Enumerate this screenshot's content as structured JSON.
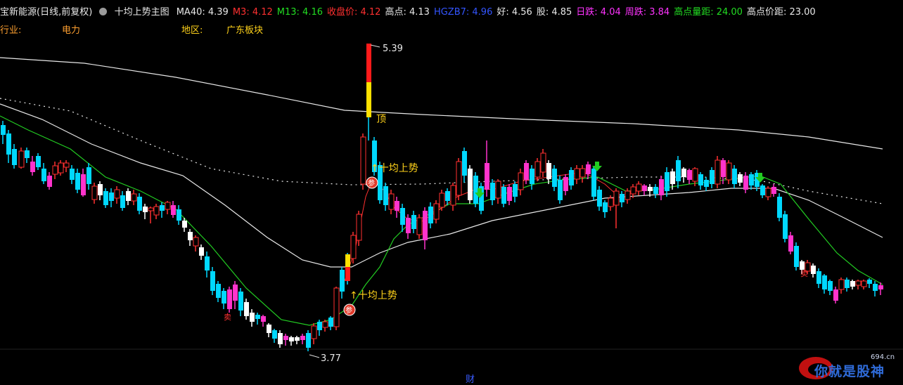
{
  "header": {
    "stock": "宝新能源(日线,前复权)",
    "indicator": "十均上势主图",
    "items": [
      {
        "label": "MA40:",
        "value": "4.39",
        "color": "#e8e8e8"
      },
      {
        "label": "M3:",
        "value": "4.12",
        "color": "#ff3030"
      },
      {
        "label": "M13:",
        "value": "4.16",
        "color": "#22dd22"
      },
      {
        "label": "收盘价:",
        "value": "4.12",
        "color": "#ff3030"
      },
      {
        "label": "高点:",
        "value": "4.13",
        "color": "#e8e8e8"
      },
      {
        "label": "HGZB7:",
        "value": "4.96",
        "color": "#3355ff"
      },
      {
        "label": "好:",
        "value": "4.56",
        "color": "#e8e8e8"
      },
      {
        "label": "股:",
        "value": "4.85",
        "color": "#e8e8e8"
      },
      {
        "label": "日跌:",
        "value": "4.04",
        "color": "#ff33ff"
      },
      {
        "label": "周跌:",
        "value": "3.84",
        "color": "#ff33ff"
      },
      {
        "label": "高点量距:",
        "value": "24.00",
        "color": "#22dd22"
      },
      {
        "label": "高点价距:",
        "value": "23.00",
        "color": "#e8e8e8"
      }
    ]
  },
  "info": {
    "industry_label": "行业:",
    "industry_value": "电力",
    "region_label": "地区:",
    "region_value": "广东板块"
  },
  "chart_annotations": {
    "high_label": "5.39",
    "low_label": "3.77",
    "top_marker": "顶",
    "signal_1": "↑十均上势",
    "signal_2": "↑十均上势",
    "badge": "参",
    "bottom_marker": "财",
    "sell_marker": "卖"
  },
  "watermark": {
    "site": "694.cn",
    "text": "你就是股神"
  },
  "chart_data": {
    "type": "candlestick",
    "price_range": [
      3.77,
      5.39
    ],
    "high": 5.39,
    "low": 3.77,
    "series": [
      {
        "name": "MA40"
      },
      {
        "name": "M3"
      },
      {
        "name": "M13"
      }
    ],
    "colors": {
      "up": "#ff3030",
      "down": "#00d8ff",
      "strong_up": "#ff33cc",
      "neutral": "#ffffff",
      "ma40": "#e8e8e8",
      "m13": "#22cc22",
      "m3": "#ff3030"
    }
  }
}
